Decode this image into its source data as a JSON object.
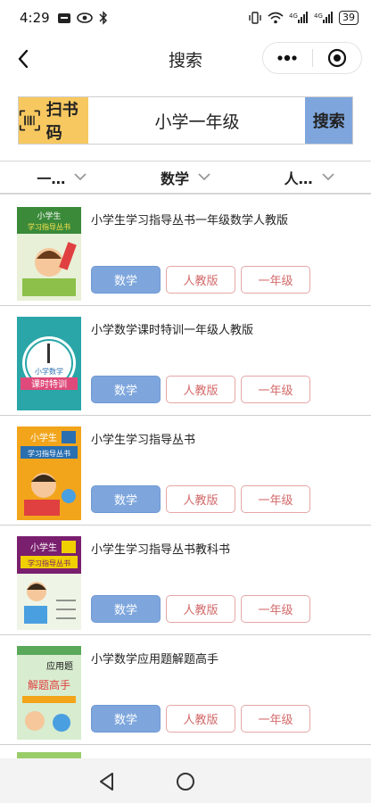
{
  "status_bar": {
    "time": "4:29",
    "left_icons": [
      "message-icon",
      "eye-icon",
      "bluetooth-icon"
    ],
    "right_icons": [
      "vibrate-icon",
      "wifi-icon",
      "signal-4g-icon",
      "signal-4g-icon"
    ],
    "battery": "39"
  },
  "navbar": {
    "title": "搜索"
  },
  "search": {
    "scan_label": "扫书码",
    "query": "小学一年级",
    "search_label": "搜索"
  },
  "filters": [
    {
      "label": "一…"
    },
    {
      "label": "数学"
    },
    {
      "label": "人…"
    }
  ],
  "books": [
    {
      "title": "小学生学习指导丛书一年级数学人教版",
      "tags": [
        "数学",
        "人教版",
        "一年级"
      ]
    },
    {
      "title": "小学数学课时特训一年级人教版",
      "tags": [
        "数学",
        "人教版",
        "一年级"
      ]
    },
    {
      "title": "小学生学习指导丛书",
      "tags": [
        "数学",
        "人教版",
        "一年级"
      ]
    },
    {
      "title": "小学生学习指导丛书教科书",
      "tags": [
        "数学",
        "人教版",
        "一年级"
      ]
    },
    {
      "title": "小学数学应用题解题高手",
      "tags": [
        "数学",
        "人教版",
        "一年级"
      ]
    }
  ],
  "covers": [
    {
      "top": "小学生",
      "sub": "学习指导丛书",
      "bg": "#e8f0d8",
      "band": "#3a8a3a"
    },
    {
      "top": "小学数学",
      "sub": "课时特训",
      "bg": "#2aa6a8",
      "band": "#e04a7a"
    },
    {
      "top": "小学生",
      "sub": "学习指导丛书",
      "bg": "#f2a51b",
      "band": "#2a6fb0"
    },
    {
      "top": "小学生",
      "sub": "学习指导丛书",
      "bg": "#7a1f6e",
      "band": "#f0d000"
    },
    {
      "top": "应用题",
      "sub": "解题高手",
      "bg": "#d8ecd0",
      "band": "#e04040"
    }
  ],
  "colors": {
    "scan_bg": "#f7c860",
    "search_btn_bg": "#7ea6dd",
    "tag_primary": "#7ea6dd",
    "tag_outline": "#d36a6a"
  }
}
